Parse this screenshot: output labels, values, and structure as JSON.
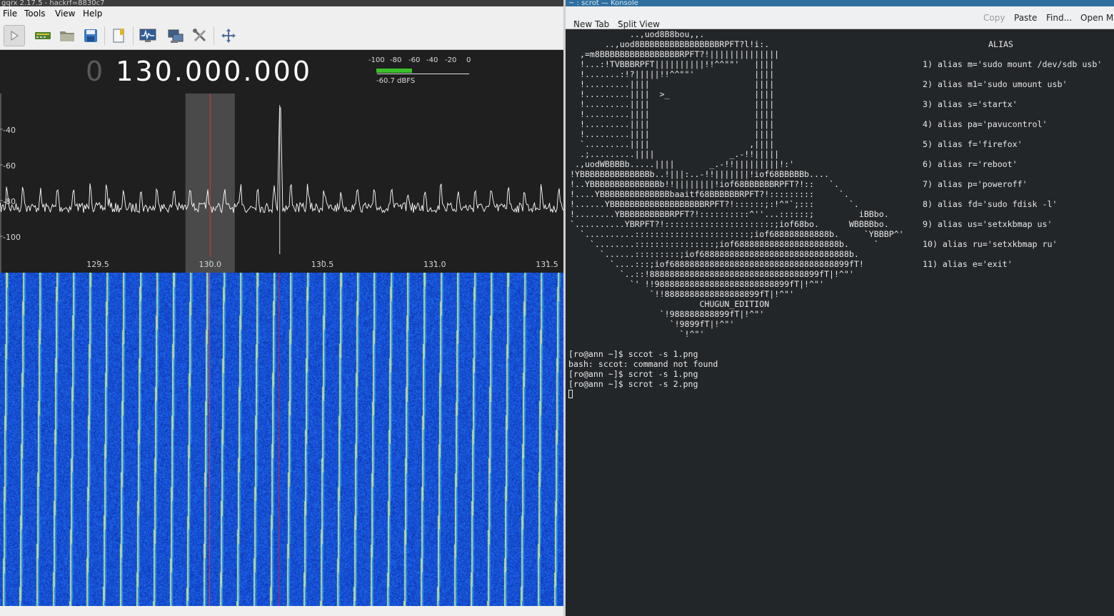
{
  "gqrx": {
    "title": "gqrx 2.17.5 - hackrf=8830c7",
    "menu": [
      "File",
      "Tools",
      "View",
      "Help"
    ],
    "toolbar_icons": [
      "play-icon",
      "hardware-icon",
      "open-file-icon",
      "save-icon",
      "bookmark-icon",
      "fft-settings-icon",
      "network-icon",
      "tools-icon",
      "fullscreen-icon"
    ],
    "frequency": {
      "dim": "0",
      "main": "130.000.000"
    },
    "smeter": {
      "scale": [
        "-100",
        "-80",
        "-60",
        "-40",
        "-20",
        "0"
      ],
      "reading": "-60.7 dBFS",
      "level_fraction": 0.39
    },
    "spectrum": {
      "y_ticks": [
        "-40",
        "-60",
        "-80",
        "-100"
      ],
      "x_ticks": [
        "129.5",
        "130.0",
        "130.5",
        "131.0",
        "131.5"
      ],
      "center_mhz": 130.0,
      "filter_low_mhz": 129.89,
      "filter_high_mhz": 130.11,
      "peak_mhz": 130.31
    },
    "colors": {
      "filter": "#4a4a4a",
      "marker": "#e03030",
      "trace": "#ffffff",
      "waterfall": "#1f4fd6"
    }
  },
  "konsole": {
    "title": "~ : scrot — Konsole",
    "toolbar": {
      "new_tab": "New Tab",
      "split_view": "Split View",
      "copy": "Copy",
      "paste": "Paste",
      "find": "Find...",
      "open_menu": "Open Me"
    },
    "ascii_art": "            ..,uod8B8bou,,.\n       ..,uod8BBBBBBBBBBBBBBBBRPFT?l!i:.\n  ,=m8BBBBBBBBBBBBBBBBRPFT?!||||||||||||||\n  !...:!TVBBBRPFT||||||||||!!^^\"\"'   ||||\n  !.......:!?|||||!!^^\"\"'            ||||\n  !.........||||                     ||||\n  !.........||||  >_                 ||||\n  !.........||||                     ||||\n  !.........||||                     ||||\n  !.........||||                     ||||\n  !.........||||                     ||||\n  `.........||||                    ,||||\n  .;.........||||               _.-!!|||||\n .,uodWBBBBb.....||||       _.-!!|||||||||!:'\n!YBBBBBBBBBBBBBBb..!|||:..-!!|||||||!iof68BBBBBb....\n!..YBBBBBBBBBBBBBBb!!||||||||!iof68BBBBBBRPFT?!::   `.\n!....YBBBBBBBBBBBBBBbaaitf68BBBBBBRPFT?!:::::::::     `.\n!......YBBBBBBBBBBBBBBBBBBBRPFT?!::::::;:!^\"`;:::       `.\n!........YBBBBBBBBBBRPFT?!::::::::::^''...::::::;         iBBbo.\n`..........YBRPFT?!::::::::::::::::::::::;iof68bo.      WBBBBbo.\n  `..........:::::::::::::::::::::::;iof688888888888b.     `YBBBP^'\n    `........::::::::::::::::;iof688888888888888888888b.     `\n      `......:::::::::;iof688888888888888888888888888888b.\n        `....:::;iof688888888888888888888888888888888899fT!\n          `..::!8888888888888888888888888888888899fT|!^\"'\n            `' !!988888888888888888888888899fT|!^\"'\n                `!!8888888888888888899fT|!^\"'\n                          CHUGUN_EDITION\n                  `!988888888899fT|!^\"'\n                    `!9899fT|!^\"'\n                      `!^\"'",
    "alias_title": "ALIAS",
    "aliases": [
      "1) alias m='sudo mount /dev/sdb usb'",
      "2) alias m1='sudo umount usb'",
      "3) alias s='startx'",
      "4) alias pa='pavucontrol'",
      "5) alias f='firefox'",
      "6) alias r='reboot'",
      "7) alias p='poweroff'",
      "8) alias fd='sudo fdisk -l'",
      "9) alias us='setxkbmap us'",
      "10) alias ru='setxkbmap ru'",
      "11) alias e='exit'"
    ],
    "commands": [
      "[ro@ann ~]$ sccot -s 1.png",
      "bash: sccot: command not found",
      "[ro@ann ~]$ scrot -s 1.png",
      "[ro@ann ~]$ scrot -s 2.png"
    ]
  }
}
